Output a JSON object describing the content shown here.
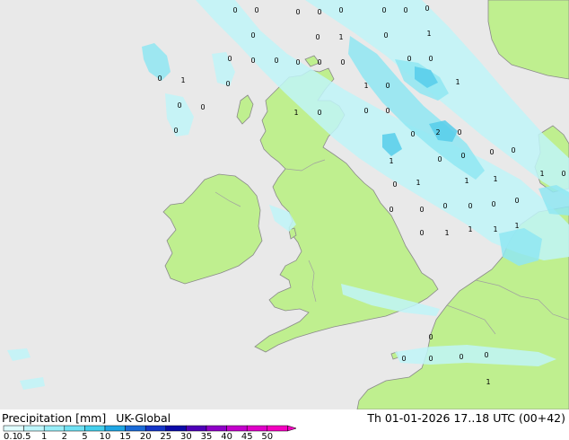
{
  "title": {
    "variable": "Precipitation [mm]",
    "model": "UK-Global"
  },
  "valid_time": "Th 01-01-2026 17..18 UTC (00+42)",
  "legend": {
    "labels": [
      "0.1",
      "0.5",
      "1",
      "2",
      "5",
      "10",
      "15",
      "20",
      "25",
      "30",
      "35",
      "40",
      "45",
      "50"
    ],
    "colors": [
      "#e0fdff",
      "#bef6fb",
      "#98eef8",
      "#6fe1f3",
      "#44cfec",
      "#1ea6e4",
      "#1a6ad8",
      "#1435c8",
      "#0b0aa8",
      "#4e00b8",
      "#8f00c8",
      "#c400cc",
      "#e000c8",
      "#f400c0"
    ]
  },
  "map_colors": {
    "sea": "#e9e9e9",
    "land": "#bfef8f",
    "coast": "#8a8a8a",
    "border": "#a0a0a0",
    "precip_light": "#bff4f8",
    "precip_mid": "#8fe6f2",
    "precip_heavy": "#56cdea"
  },
  "station_values": [
    {
      "v": "0"
    },
    {
      "v": "0"
    },
    {
      "v": "0"
    },
    {
      "v": "0"
    },
    {
      "v": "0"
    },
    {
      "v": "0"
    },
    {
      "v": "0"
    },
    {
      "v": "0"
    },
    {
      "v": "1"
    },
    {
      "v": "0"
    },
    {
      "v": "1"
    },
    {
      "v": "0"
    },
    {
      "v": "0"
    },
    {
      "v": "0"
    },
    {
      "v": "0"
    },
    {
      "v": "0"
    },
    {
      "v": "0"
    },
    {
      "v": "0"
    },
    {
      "v": "0"
    },
    {
      "v": "0"
    },
    {
      "v": "0"
    },
    {
      "v": "1"
    },
    {
      "v": "0"
    },
    {
      "v": "1"
    },
    {
      "v": "0"
    },
    {
      "v": "1"
    },
    {
      "v": "1"
    },
    {
      "v": "0"
    },
    {
      "v": "0"
    },
    {
      "v": "0"
    },
    {
      "v": "0"
    },
    {
      "v": "2"
    },
    {
      "v": "0"
    },
    {
      "v": "0"
    },
    {
      "v": "0"
    },
    {
      "v": "1"
    },
    {
      "v": "0"
    },
    {
      "v": "0"
    },
    {
      "v": "0"
    },
    {
      "v": "0"
    },
    {
      "v": "1"
    },
    {
      "v": "1"
    },
    {
      "v": "0"
    },
    {
      "v": "0"
    },
    {
      "v": "0"
    },
    {
      "v": "0"
    },
    {
      "v": "1"
    },
    {
      "v": "0"
    },
    {
      "v": "1"
    },
    {
      "v": "1"
    },
    {
      "v": "1"
    },
    {
      "v": "1"
    },
    {
      "v": "0"
    },
    {
      "v": "0"
    },
    {
      "v": "1"
    },
    {
      "v": "0"
    },
    {
      "v": "0"
    },
    {
      "v": "0"
    },
    {
      "v": "0"
    },
    {
      "v": "0"
    },
    {
      "v": "0"
    },
    {
      "v": "0"
    },
    {
      "v": "1"
    },
    {
      "v": "0"
    },
    {
      "v": "0"
    }
  ]
}
